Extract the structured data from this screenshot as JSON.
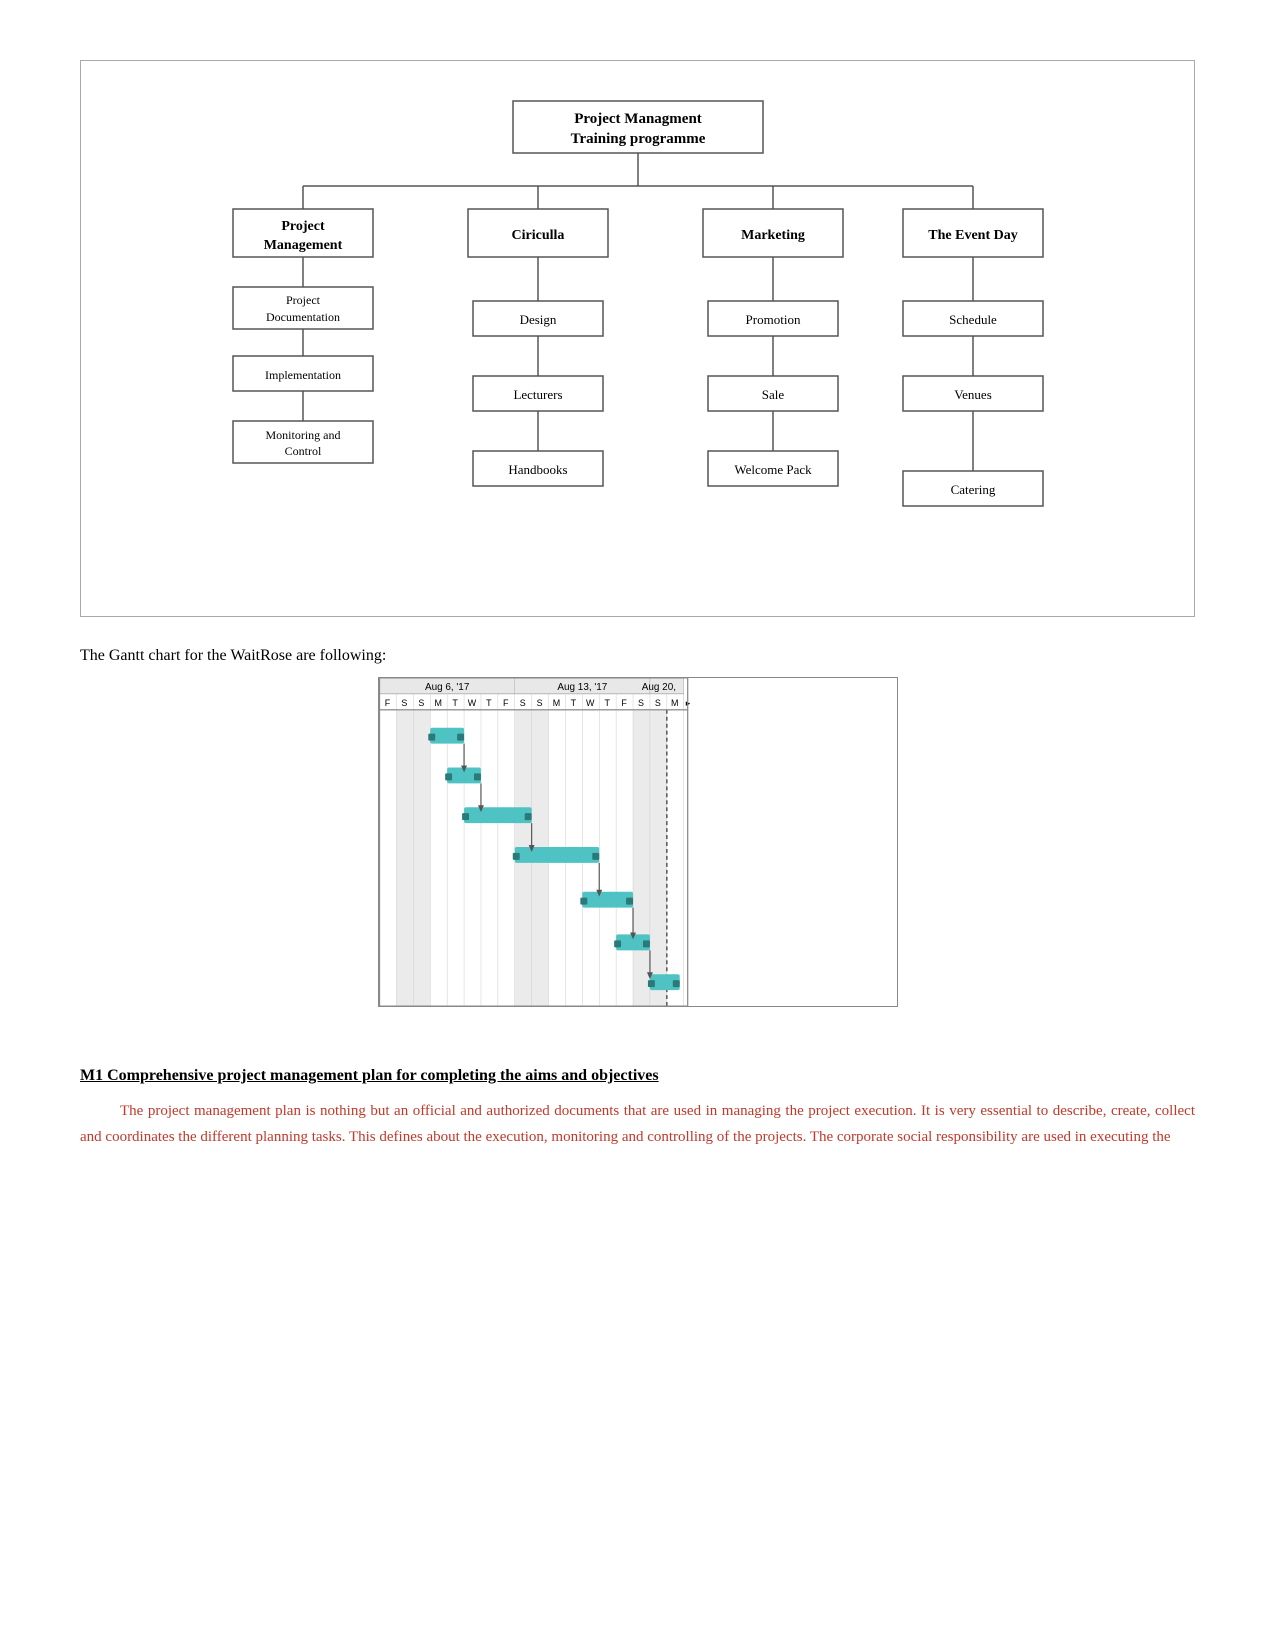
{
  "orgChart": {
    "root": {
      "line1": "Project Managment",
      "line2": "Training programme"
    },
    "level1": [
      {
        "label": "Project\nManagement"
      },
      {
        "label": "Ciriculla"
      },
      {
        "label": "Marketing"
      },
      {
        "label": "The Event Day"
      }
    ],
    "level2": {
      "col0": [
        "Project\nDocumentation",
        "Implementation",
        "Monitoring and\nControl"
      ],
      "col1": [
        "Design",
        "Lecturers",
        "Handbooks"
      ],
      "col2": [
        "Promotion",
        "Sale",
        "Welcome Pack"
      ],
      "col3": [
        "Schedule",
        "Venues",
        "Catering"
      ]
    }
  },
  "gantt": {
    "intro": "The Gantt chart for the WaitRose are following:",
    "weeks": [
      {
        "label": "Aug 6, '17",
        "days": [
          "F",
          "S",
          "S",
          "M",
          "T",
          "W",
          "T",
          "F"
        ]
      },
      {
        "label": "Aug 13, '17",
        "days": [
          "S",
          "S",
          "M",
          "T",
          "W",
          "T",
          "F",
          "S"
        ]
      },
      {
        "label": "Aug 20,",
        "days": [
          "S",
          "M"
        ]
      }
    ]
  },
  "section": {
    "heading": "M1 Comprehensive project management plan for completing the aims and objectives",
    "paragraph": "The project management plan is nothing but an official and authorized documents that are used in managing the project execution. It is very essential to describe, create, collect and coordinates the different planning tasks. This defines about the execution, monitoring and controlling of the projects. The corporate social responsibility are used in executing the"
  }
}
